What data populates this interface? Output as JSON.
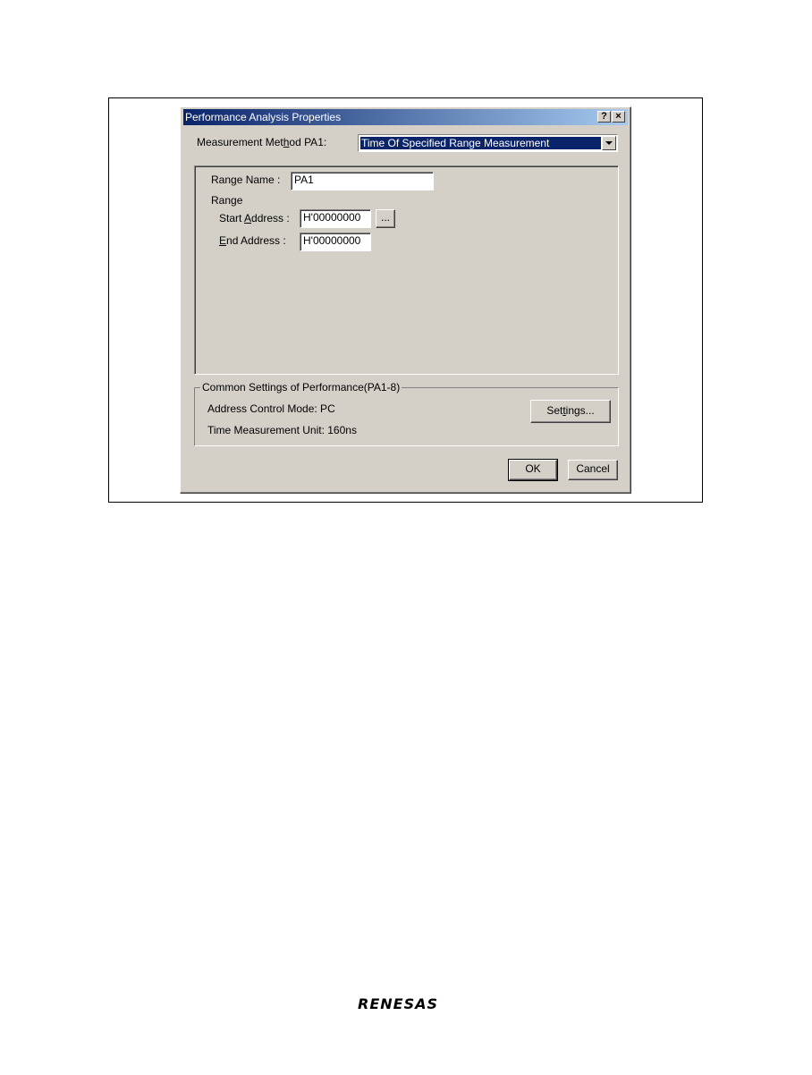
{
  "dialog": {
    "title": "Performance Analysis Properties",
    "help_button": "?",
    "close_button": "×"
  },
  "measurement": {
    "label_before": "Measurement Met",
    "label_key": "h",
    "label_after": "od PA1:",
    "selected": "Time Of Specified Range Measurement"
  },
  "range": {
    "name_label_before": "Ran",
    "name_label_key": "g",
    "name_label_after": "e Name :",
    "name_value": "PA1",
    "range_label": "Range",
    "start_label_before": "Start ",
    "start_label_key": "A",
    "start_label_after": "ddress :",
    "start_value": "H'00000000",
    "browse_button": "...",
    "end_label_key": "E",
    "end_label_after": "nd Address :",
    "end_value": "H'00000000"
  },
  "common": {
    "group_title": "Common Settings of Performance(PA1-8)",
    "address_mode": "Address Control Mode: PC",
    "time_unit": "Time Measurement Unit: 160ns",
    "settings_before": "Set",
    "settings_key": "t",
    "settings_after": "ings..."
  },
  "footer": {
    "ok": "OK",
    "cancel": "Cancel"
  },
  "brand": {
    "logo_text": "RENESAS"
  },
  "colors": {
    "titlebar_start": "#0a246a",
    "titlebar_end": "#a6caf0",
    "dialog_bg": "#d4d0c8"
  }
}
